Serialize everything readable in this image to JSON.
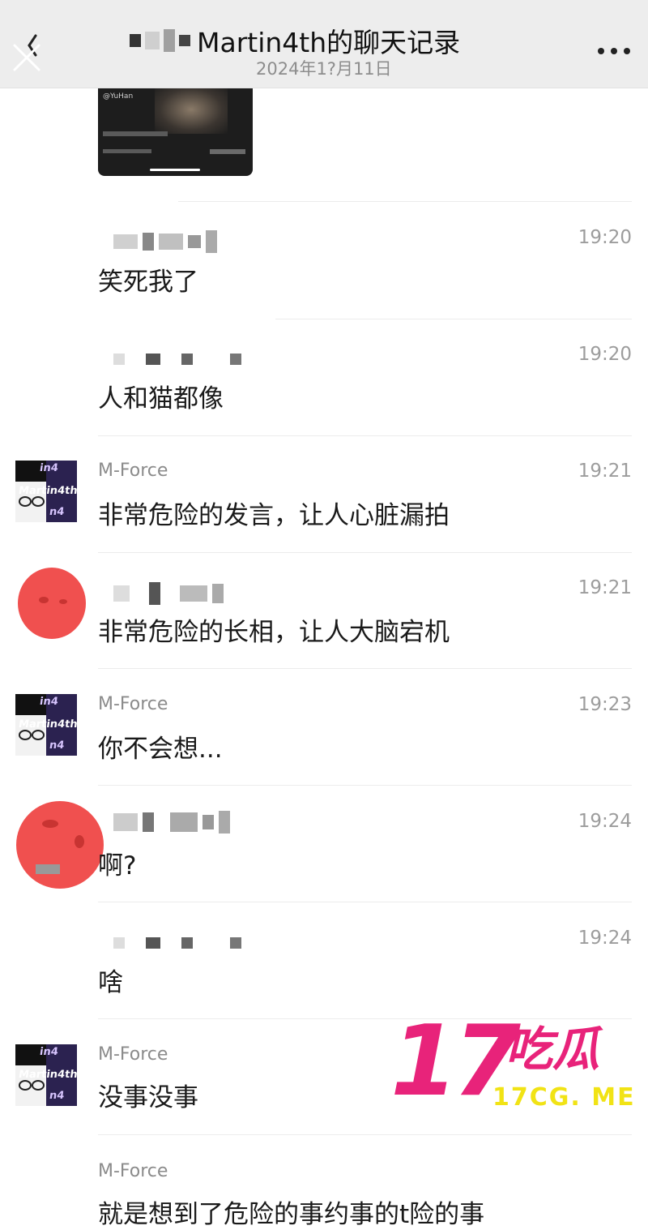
{
  "header": {
    "title": "Martin4th的聊天记录",
    "subtitle": "2024年1?月11日"
  },
  "image_message": {
    "caption_user": "@YuHan"
  },
  "messages": [
    {
      "sender": "",
      "time": "19:20",
      "text": "笑死我了",
      "avatar": "none"
    },
    {
      "sender": "",
      "time": "19:20",
      "text": "人和猫都像",
      "avatar": "none"
    },
    {
      "sender": "M-Force",
      "time": "19:21",
      "text": "非常危险的发言，让人心脏漏拍",
      "avatar": "martin4th"
    },
    {
      "sender": "",
      "time": "19:21",
      "text": "非常危险的长相，让人大脑宕机",
      "avatar": "redacted"
    },
    {
      "sender": "M-Force",
      "time": "19:23",
      "text": "你不会想...",
      "avatar": "martin4th"
    },
    {
      "sender": "",
      "time": "19:24",
      "text": "啊?",
      "avatar": "redacted"
    },
    {
      "sender": "",
      "time": "19:24",
      "text": "啥",
      "avatar": "none"
    },
    {
      "sender": "M-Force",
      "time": "",
      "text": "没事没事",
      "avatar": "martin4th"
    },
    {
      "sender": "M-Force",
      "time": "",
      "text": "就是想到了危险的事约事的t险的事",
      "avatar": "none"
    }
  ],
  "avatar_text": "Martin4th",
  "watermark": {
    "number": "17",
    "chinese": "吃瓜",
    "url": "17CG. ME"
  },
  "colors": {
    "header_bg": "#ededed",
    "watermark_pink": "#e8237a",
    "watermark_yellow": "#f1e315",
    "redaction_red": "#f0504f"
  }
}
